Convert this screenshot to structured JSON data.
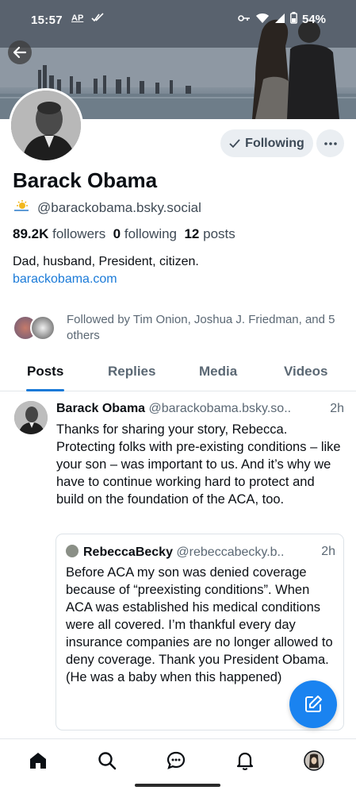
{
  "status_bar": {
    "time": "15:57",
    "ap_label": "AP",
    "battery": "54%"
  },
  "profile": {
    "name": "Barack Obama",
    "handle": "@barackobama.bsky.social",
    "follow_button_label": "Following",
    "followers_count": "89.2K",
    "followers_label": "followers",
    "following_count": "0",
    "following_label": "following",
    "posts_count": "12",
    "posts_label": "posts",
    "bio": "Dad, husband, President, citizen.",
    "website": "barackobama.com",
    "followed_by": "Followed by Tim Onion, Joshua J. Friedman, and 5 others"
  },
  "tabs": [
    {
      "label": "Posts",
      "active": true
    },
    {
      "label": "Replies",
      "active": false
    },
    {
      "label": "Media",
      "active": false
    },
    {
      "label": "Videos",
      "active": false
    }
  ],
  "post": {
    "author_name": "Barack Obama",
    "author_handle": "@barackobama.bsky.so..",
    "time": "2h",
    "text": "Thanks for sharing your story, Rebecca. Protecting folks with pre-existing conditions – like your son – was important to us. And it’s why we have to continue working hard to protect and build on the foundation of the ACA, too.",
    "quote": {
      "author_name": "RebeccaBecky",
      "author_handle": "@rebeccabecky.b..",
      "time": "2h",
      "text": "Before ACA my son was denied coverage because of “preexisting conditions”. When ACA was established his medical conditions were all covered. I’m thankful every day insurance companies are no longer allowed to deny coverage. Thank you President Obama. (He was a baby when this happened)"
    }
  },
  "nav": {
    "icons": [
      "home-icon",
      "search-icon",
      "chat-icon",
      "bell-icon",
      "profile-avatar"
    ]
  },
  "colors": {
    "accent": "#1a7ad8",
    "fab": "#1a83f0",
    "muted_text": "#5b6874"
  }
}
